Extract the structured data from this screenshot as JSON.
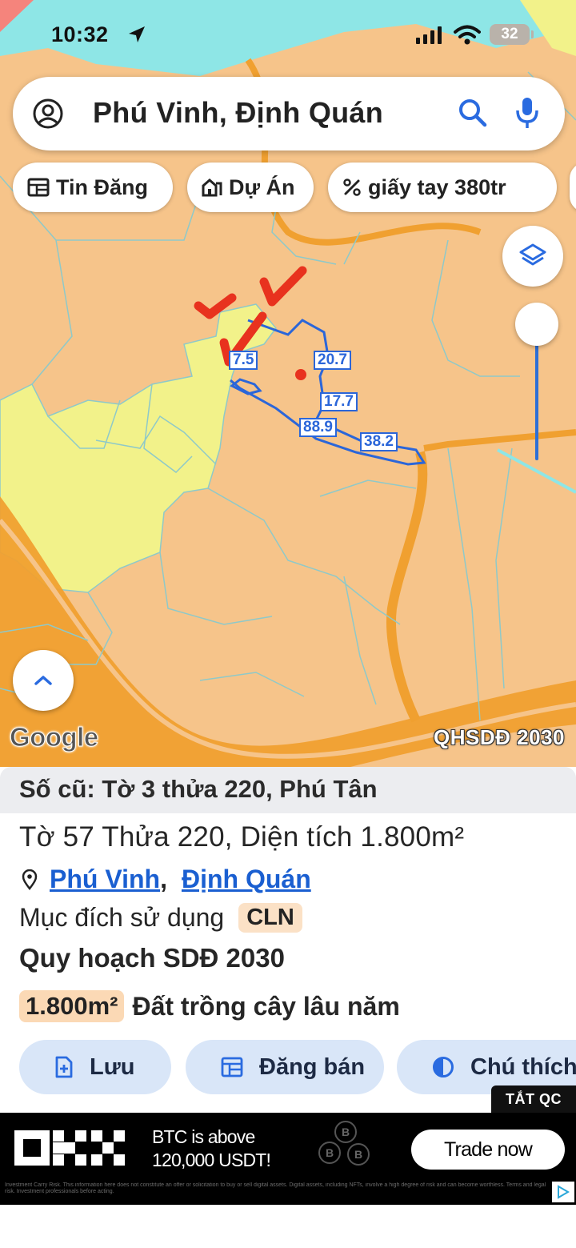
{
  "status_bar": {
    "time": "10:32",
    "battery": "32"
  },
  "search": {
    "query": "Phú Vinh, Định Quán"
  },
  "chips": [
    {
      "label": "Tin Đăng",
      "icon": "listing-icon"
    },
    {
      "label": "Dự Án",
      "icon": "building-icon"
    },
    {
      "label": "giấy tay 380tr",
      "icon": "percent-icon"
    }
  ],
  "map": {
    "attribution": "Google",
    "layer_badge": "QHSDĐ 2030",
    "dimensions": [
      "7.5",
      "20.7",
      "17.7",
      "88.9",
      "38.2"
    ],
    "colors": {
      "land": "#f6c48a",
      "yellow_zone": "#f2f28a",
      "road": "#f0a030",
      "boundary": "#2b66d9"
    }
  },
  "info": {
    "old_number": "Số cũ: Tờ 3 thửa 220, Phú Tân",
    "parcel_line": "Tờ 57 Thửa 220, Diện tích 1.800m²",
    "ward": "Phú Vinh",
    "separator": ",",
    "district": "Định Quán",
    "purpose_label": "Mục đích sử dụng",
    "purpose_code": "CLN",
    "plan_title": "Quy hoạch SDĐ 2030",
    "plan_area": "1.800m²",
    "plan_desc": "Đất trồng cây lâu năm"
  },
  "actions": {
    "save": "Lưu",
    "post": "Đăng bán",
    "legend": "Chú thích"
  },
  "ad": {
    "close_label": "TẮT QC",
    "headline_line1": "BTC is above",
    "headline_line2": "120,000 USDT!",
    "cta": "Trade now",
    "disclaimer": "Investment Carry Risk. This information here does not constitute an offer or solicitation to buy or sell digital assets. Digital assets, including NFTs, involve a high degree of risk and can become worthless. Terms and legal risk. Investment professionals before acting."
  }
}
